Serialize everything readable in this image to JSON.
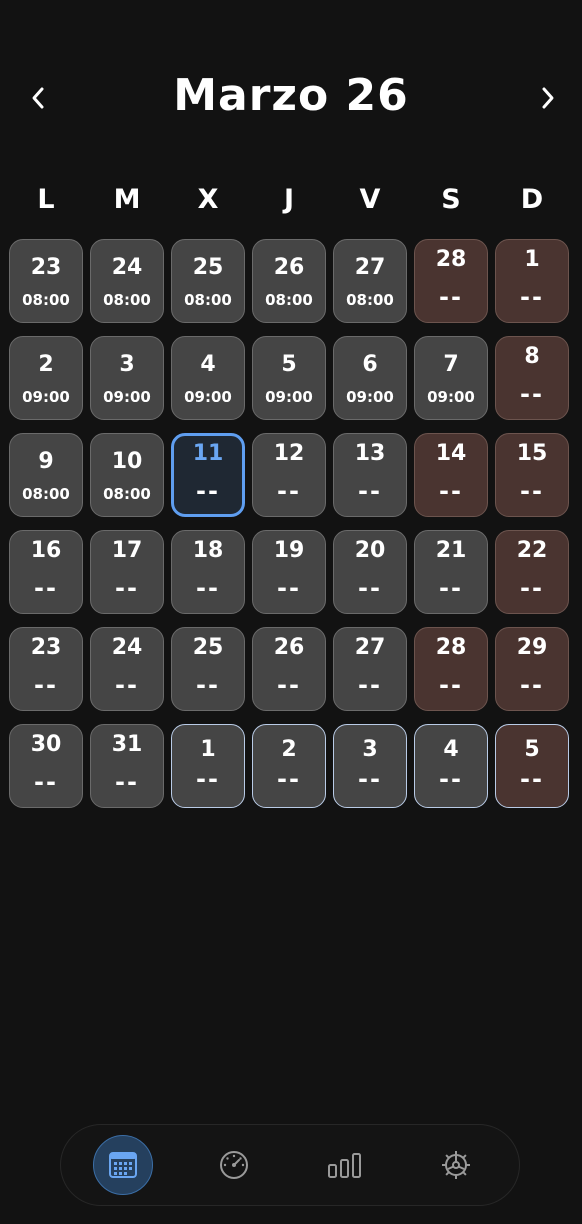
{
  "header": {
    "title": "Marzo 26",
    "prev_icon": "chevron-left-icon",
    "next_icon": "chevron-right-icon"
  },
  "weekdays": [
    "L",
    "M",
    "X",
    "J",
    "V",
    "S",
    "D"
  ],
  "weeks": [
    [
      {
        "day": "23",
        "time": "08:00",
        "state": "past"
      },
      {
        "day": "24",
        "time": "08:00",
        "state": "past"
      },
      {
        "day": "25",
        "time": "08:00",
        "state": "past"
      },
      {
        "day": "26",
        "time": "08:00",
        "state": "past"
      },
      {
        "day": "27",
        "time": "08:00",
        "state": "past"
      },
      {
        "day": "28",
        "time": "--",
        "state": "weekend"
      },
      {
        "day": "1",
        "time": "--",
        "state": "weekend"
      }
    ],
    [
      {
        "day": "2",
        "time": "09:00",
        "state": "past"
      },
      {
        "day": "3",
        "time": "09:00",
        "state": "past"
      },
      {
        "day": "4",
        "time": "09:00",
        "state": "past"
      },
      {
        "day": "5",
        "time": "09:00",
        "state": "past"
      },
      {
        "day": "6",
        "time": "09:00",
        "state": "past"
      },
      {
        "day": "7",
        "time": "09:00",
        "state": "past"
      },
      {
        "day": "8",
        "time": "--",
        "state": "weekend"
      }
    ],
    [
      {
        "day": "9",
        "time": "08:00",
        "state": "past"
      },
      {
        "day": "10",
        "time": "08:00",
        "state": "past"
      },
      {
        "day": "11",
        "time": "--",
        "state": "today"
      },
      {
        "day": "12",
        "time": "--",
        "state": "normal"
      },
      {
        "day": "13",
        "time": "--",
        "state": "normal"
      },
      {
        "day": "14",
        "time": "--",
        "state": "weekend"
      },
      {
        "day": "15",
        "time": "--",
        "state": "weekend"
      }
    ],
    [
      {
        "day": "16",
        "time": "--",
        "state": "normal"
      },
      {
        "day": "17",
        "time": "--",
        "state": "normal"
      },
      {
        "day": "18",
        "time": "--",
        "state": "normal"
      },
      {
        "day": "19",
        "time": "--",
        "state": "normal"
      },
      {
        "day": "20",
        "time": "--",
        "state": "normal"
      },
      {
        "day": "21",
        "time": "--",
        "state": "normal"
      },
      {
        "day": "22",
        "time": "--",
        "state": "weekend"
      }
    ],
    [
      {
        "day": "23",
        "time": "--",
        "state": "normal"
      },
      {
        "day": "24",
        "time": "--",
        "state": "normal"
      },
      {
        "day": "25",
        "time": "--",
        "state": "normal"
      },
      {
        "day": "26",
        "time": "--",
        "state": "normal"
      },
      {
        "day": "27",
        "time": "--",
        "state": "normal"
      },
      {
        "day": "28",
        "time": "--",
        "state": "weekend"
      },
      {
        "day": "29",
        "time": "--",
        "state": "weekend"
      }
    ],
    [
      {
        "day": "30",
        "time": "--",
        "state": "normal"
      },
      {
        "day": "31",
        "time": "--",
        "state": "normal"
      },
      {
        "day": "1",
        "time": "--",
        "state": "next"
      },
      {
        "day": "2",
        "time": "--",
        "state": "next"
      },
      {
        "day": "3",
        "time": "--",
        "state": "next"
      },
      {
        "day": "4",
        "time": "--",
        "state": "next"
      },
      {
        "day": "5",
        "time": "--",
        "state": "next-weekend"
      }
    ]
  ],
  "colors": {
    "background": "#121212",
    "cell": "#454545",
    "weekend_cell": "#4a3430",
    "today_border": "#5f9ef0",
    "today_text": "#6aa6f2",
    "next_month_border": "#b9cbe6",
    "active_tab": "#25405e"
  },
  "tabbar": {
    "tabs": [
      {
        "icon": "calendar-icon",
        "active": true
      },
      {
        "icon": "gauge-icon",
        "active": false
      },
      {
        "icon": "bar-chart-icon",
        "active": false
      },
      {
        "icon": "settings-gear-icon",
        "active": false
      }
    ]
  }
}
